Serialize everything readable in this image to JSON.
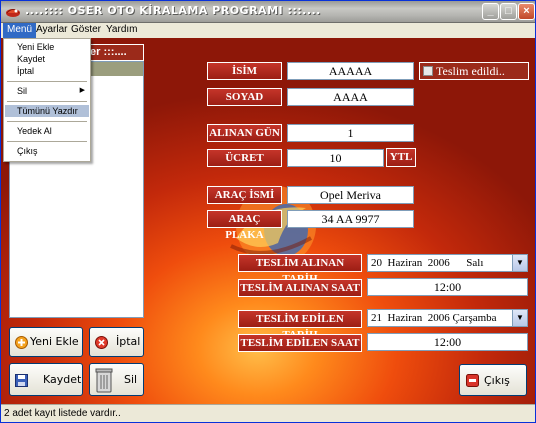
{
  "window": {
    "title": "....:::: OSER OTO KİRALAMA PROGRAMI :::....",
    "controls": [
      "_",
      "□",
      "×"
    ]
  },
  "menubar": [
    "Menü",
    "Ayarlar",
    "Göster",
    "Yardım"
  ],
  "menu_dropdown": {
    "items": [
      "Yeni Ekle",
      "Kaydet",
      "İptal",
      "Sil",
      "Tümünü Yazdır",
      "Yedek Al",
      "Çıkış"
    ],
    "submenu_arrow": "▶"
  },
  "left_panel": {
    "header_suffix": "er :::...."
  },
  "form": {
    "isim_label": "İSİM",
    "isim_value": "AAAAA",
    "teslim_edildi": "Teslim edildi..",
    "soyad_label": "SOYAD",
    "soyad_value": "AAAA",
    "alinan_gun_label": "ALINAN GÜN",
    "alinan_gun_value": "1",
    "ucret_label": "ÜCRET",
    "ucret_value": "10",
    "currency": "YTL",
    "arac_ismi_label": "ARAÇ İSMİ",
    "arac_ismi_value": "Opel Meriva",
    "arac_plaka_label": "ARAÇ PLAKA",
    "arac_plaka_value": "34 AA 9977",
    "teslim_alinan_tarih_label": "TESLİM ALINAN TARİH",
    "teslim_alinan_tarih_value": "20  Haziran  2006      Salı",
    "teslim_alinan_saat_label": "TESLİM ALINAN SAAT",
    "teslim_alinan_saat_value": "12:00",
    "teslim_edilen_tarih_label": "TESLİM EDİLEN TARİH",
    "teslim_edilen_tarih_value": "21  Haziran  2006 Çarşamba",
    "teslim_edilen_saat_label": "TESLİM EDİLEN SAAT",
    "teslim_edilen_saat_value": "12:00",
    "dropdown_arrow": "▼"
  },
  "buttons": {
    "yeni_ekle": "Yeni Ekle",
    "iptal": "İptal",
    "kaydet": "Kaydet",
    "sil": "Sil",
    "cikis": "Çıkış"
  },
  "status": "2 adet kayıt listede vardır.."
}
